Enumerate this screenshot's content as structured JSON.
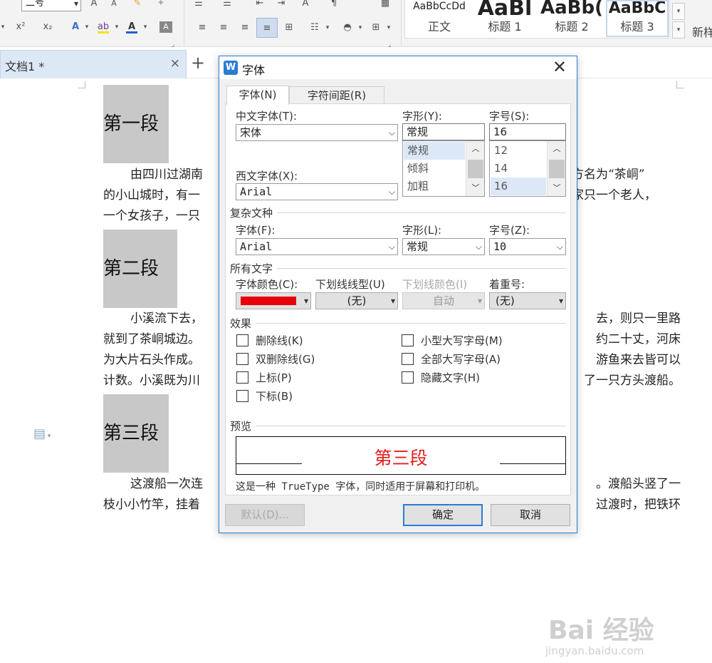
{
  "ribbon": {
    "font_size_value": "二号",
    "style_previews": [
      {
        "preview": "AaBbCcDd",
        "name": "正文"
      },
      {
        "preview": "AaBl",
        "name": "标题 1"
      },
      {
        "preview": "AaBb(",
        "name": "标题 2"
      },
      {
        "preview": "AaBbC",
        "name": "标题 3"
      }
    ],
    "new_style_label": "新样",
    "superscript_label": "x²",
    "subscript_label": "x₂"
  },
  "tabs": {
    "document_tab_label": "文档1 *",
    "close_glyph": "×",
    "new_tab_glyph": "+"
  },
  "document": {
    "headings": [
      "第一段",
      "第二段",
      "第三段"
    ],
    "paragraphs": [
      [
        "由四川过湖南",
        "的小山城时，有一",
        "一个女孩子，一只"
      ],
      [
        "小溪流下去，",
        "就到了茶峒城边。",
        "为大片石头作成。",
        "计数。小溪既为川"
      ],
      [
        "这渡船一次连",
        "枝小小竹竿，挂着"
      ]
    ],
    "paragraph_tails": [
      [
        "边方名为“茶峒”",
        "人家只一个老人，",
        ""
      ],
      [
        "去，则只一里路",
        "约二十丈，河床",
        "游鱼来去皆可以",
        "了一只方头渡船。"
      ],
      [
        "。渡船头竖了一",
        "过渡时，把铁环"
      ]
    ]
  },
  "watermark": {
    "brand": "Bai 经验",
    "url": "jingyan.baidu.com"
  },
  "dialog": {
    "title": "字体",
    "logo": "W",
    "close_glyph": "✕",
    "tabs": [
      {
        "label": "字体(N)",
        "active": true
      },
      {
        "label": "字符间距(R)",
        "active": false
      }
    ],
    "chinese_font": {
      "label": "中文字体(T):",
      "value": "宋体"
    },
    "style": {
      "label": "字形(Y):",
      "value": "常规",
      "options": [
        "常规",
        "倾斜",
        "加粗"
      ],
      "selected": "常规"
    },
    "size": {
      "label": "字号(S):",
      "value": "16",
      "options": [
        "12",
        "14",
        "16"
      ],
      "selected": "16"
    },
    "western_font": {
      "label": "西文字体(X):",
      "value": "Arial"
    },
    "complex_group": "复杂文种",
    "complex_font": {
      "label": "字体(F):",
      "value": "Arial"
    },
    "complex_style": {
      "label": "字形(L):",
      "value": "常规"
    },
    "complex_size": {
      "label": "字号(Z):",
      "value": "10"
    },
    "all_text_group": "所有文字",
    "font_color": {
      "label": "字体颜色(C):",
      "color": "#e8000b"
    },
    "underline_style": {
      "label": "下划线线型(U)",
      "value": "(无)"
    },
    "underline_color": {
      "label": "下划线颜色(I)",
      "value": "自动"
    },
    "emphasis": {
      "label": "着重号:",
      "value": "(无)"
    },
    "effects_group": "效果",
    "effects_left": [
      {
        "label": "删除线(K)",
        "checked": false
      },
      {
        "label": "双删除线(G)",
        "checked": false
      },
      {
        "label": "上标(P)",
        "checked": false
      },
      {
        "label": "下标(B)",
        "checked": false
      }
    ],
    "effects_right": [
      {
        "label": "小型大写字母(M)",
        "checked": false
      },
      {
        "label": "全部大写字母(A)",
        "checked": false
      },
      {
        "label": "隐藏文字(H)",
        "checked": false
      }
    ],
    "preview_group": "预览",
    "preview_text": "第三段",
    "preview_color": "#e31d1d",
    "note": "这是一种 TrueType 字体，同时适用于屏幕和打印机。",
    "buttons": {
      "default": "默认(D)...",
      "ok": "确定",
      "cancel": "取消"
    }
  }
}
